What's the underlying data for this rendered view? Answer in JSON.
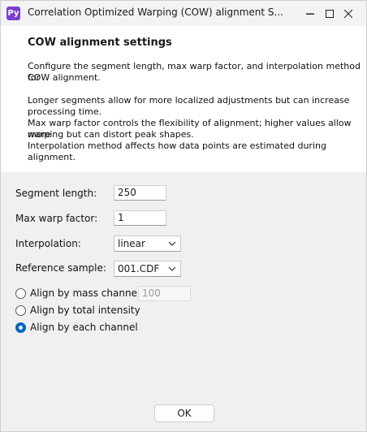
{
  "window": {
    "app_icon_text": "Py",
    "title": "Correlation Optimized Warping (COW) alignment S...",
    "icons": {
      "minimize": "minimize-icon",
      "maximize": "maximize-icon",
      "close": "close-icon"
    }
  },
  "header": {
    "title": "COW alignment settings",
    "lines": [
      "Configure the segment length, max warp factor, and interpolation method for",
      "COW alignment.",
      "Longer segments allow for more localized adjustments but can increase",
      "processing time.",
      "Max warp factor controls the flexibility of alignment; higher values allow more",
      "warping but can distort peak shapes.",
      "Interpolation method affects how data points are estimated during alignment."
    ]
  },
  "form": {
    "segment_length": {
      "label": "Segment length:",
      "value": "250"
    },
    "max_warp": {
      "label": "Max warp factor:",
      "value": "1"
    },
    "interpolation": {
      "label": "Interpolation:",
      "value": "linear"
    },
    "reference": {
      "label": "Reference sample:",
      "value": "001.CDF"
    },
    "align_mass": {
      "label": "Align by mass channel:",
      "value": "100",
      "checked": false
    },
    "align_total": {
      "label": "Align by total intensity",
      "checked": false
    },
    "align_each": {
      "label": "Align by each channel",
      "checked": true
    }
  },
  "buttons": {
    "ok": "OK"
  },
  "colors": {
    "accent": "#0067c0",
    "app_icon": "#7b3fd1"
  }
}
